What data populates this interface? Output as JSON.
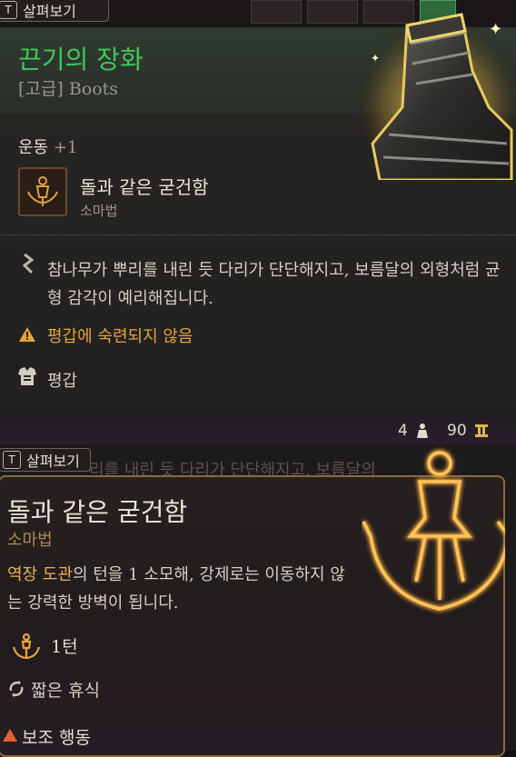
{
  "top_bar": {
    "tab_key": "T",
    "tab_label": "살펴보기"
  },
  "item": {
    "name": "끈기의 장화",
    "rarity_type": "[고급] Boots",
    "stat_name": "운동",
    "stat_bonus": "+1",
    "spell": {
      "name": "돌과 같은 굳건함",
      "school": "소마법"
    },
    "description": "참나무가 뿌리를 내린 듯 다리가 단단해지고, 보름달의 외형처럼 균형 감각이 예리해집니다.",
    "warning": "평갑에 숙련되지 않음",
    "armor_type": "평갑",
    "weight": "4",
    "value": "90"
  },
  "spell_tooltip": {
    "tab_key": "T",
    "tab_label": "살펴보기",
    "behind_text": "리를 내린 듯 다리가 단단해지고, 보름달의",
    "name": "돌과 같은 굳건함",
    "school": "소마법",
    "desc_highlight": "역장 도관",
    "desc_rest": "의 턴을 1 소모해, 강제로는 이동하지 않는 강력한 방벽이 됩니다.",
    "duration": "1턴",
    "recharge": "짧은 휴식",
    "action_type": "보조 행동"
  },
  "colors": {
    "item_name": "#3ec95a",
    "warning": "#e5a43c",
    "highlight": "#e7b25a",
    "tooltip_border": "#8a6a3c"
  },
  "icons": [
    "boot-icon",
    "anchor-figure-icon",
    "rune-icon",
    "warning-icon",
    "chest-armor-icon",
    "weight-icon",
    "coin-icon",
    "recharge-icon",
    "triangle-icon"
  ]
}
